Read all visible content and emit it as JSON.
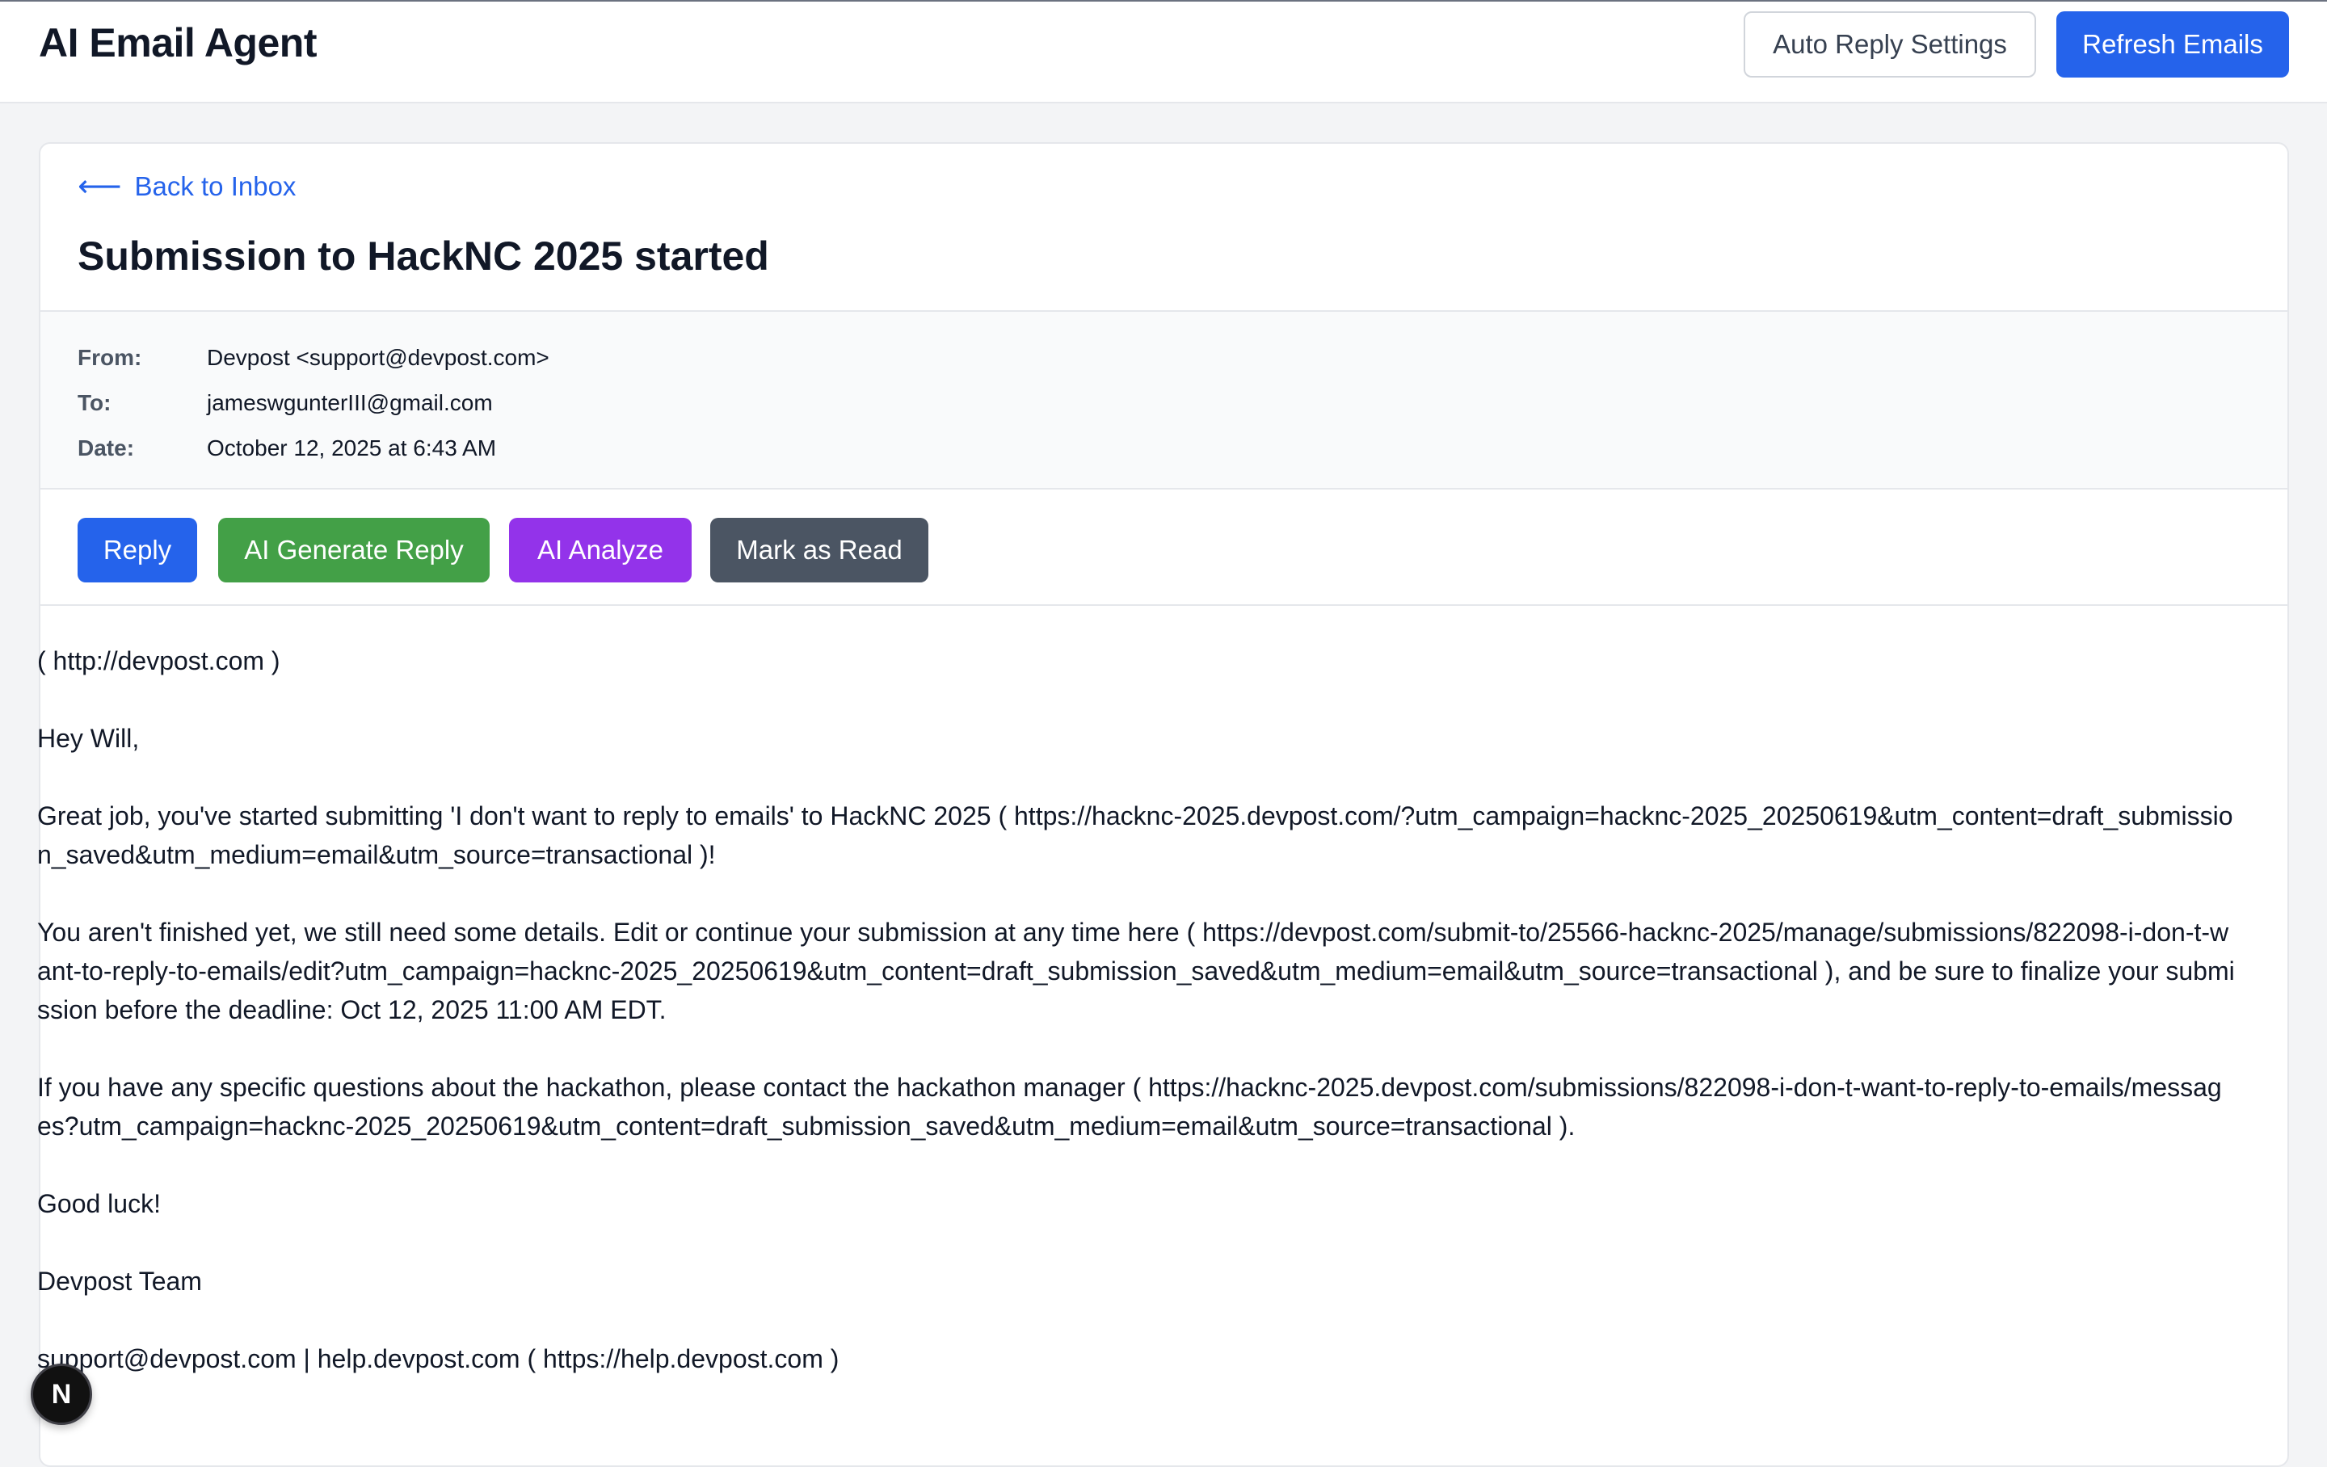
{
  "header": {
    "title": "AI Email Agent",
    "auto_reply_label": "Auto Reply Settings",
    "refresh_label": "Refresh Emails"
  },
  "email": {
    "back_arrow": "⟵",
    "back_label": "Back to Inbox",
    "subject": "Submission to HackNC 2025 started",
    "meta": {
      "from_label": "From:",
      "from_value": "Devpost <support@devpost.com>",
      "to_label": "To:",
      "to_value": "jameswgunterIII@gmail.com",
      "date_label": "Date:",
      "date_value": "October 12, 2025 at 6:43 AM"
    },
    "actions": {
      "reply": "Reply",
      "ai_generate": "AI Generate Reply",
      "ai_analyze": "AI Analyze",
      "mark_read": "Mark as Read"
    },
    "body": [
      "( http://devpost.com )",
      "Hey Will,",
      "Great job, you've started submitting 'I don't want to reply to emails' to HackNC 2025 ( https://hacknc-2025.devpost.com/?utm_campaign=hacknc-2025_20250619&utm_content=draft_submission_saved&utm_medium=email&utm_source=transactional )!",
      "You aren't finished yet, we still need some details. Edit or continue your submission at any time here ( https://devpost.com/submit-to/25566-hacknc-2025/manage/submissions/822098-i-don-t-want-to-reply-to-emails/edit?utm_campaign=hacknc-2025_20250619&utm_content=draft_submission_saved&utm_medium=email&utm_source=transactional ), and be sure to finalize your submission before the deadline: Oct 12, 2025 11:00 AM EDT.",
      "If you have any specific questions about the hackathon, please contact the hackathon manager ( https://hacknc-2025.devpost.com/submissions/822098-i-don-t-want-to-reply-to-emails/messages?utm_campaign=hacknc-2025_20250619&utm_content=draft_submission_saved&utm_medium=email&utm_source=transactional ).",
      "Good luck!",
      "Devpost Team",
      "support@devpost.com | help.devpost.com ( https://help.devpost.com )"
    ]
  },
  "overlay": {
    "badge_letter": "N"
  }
}
